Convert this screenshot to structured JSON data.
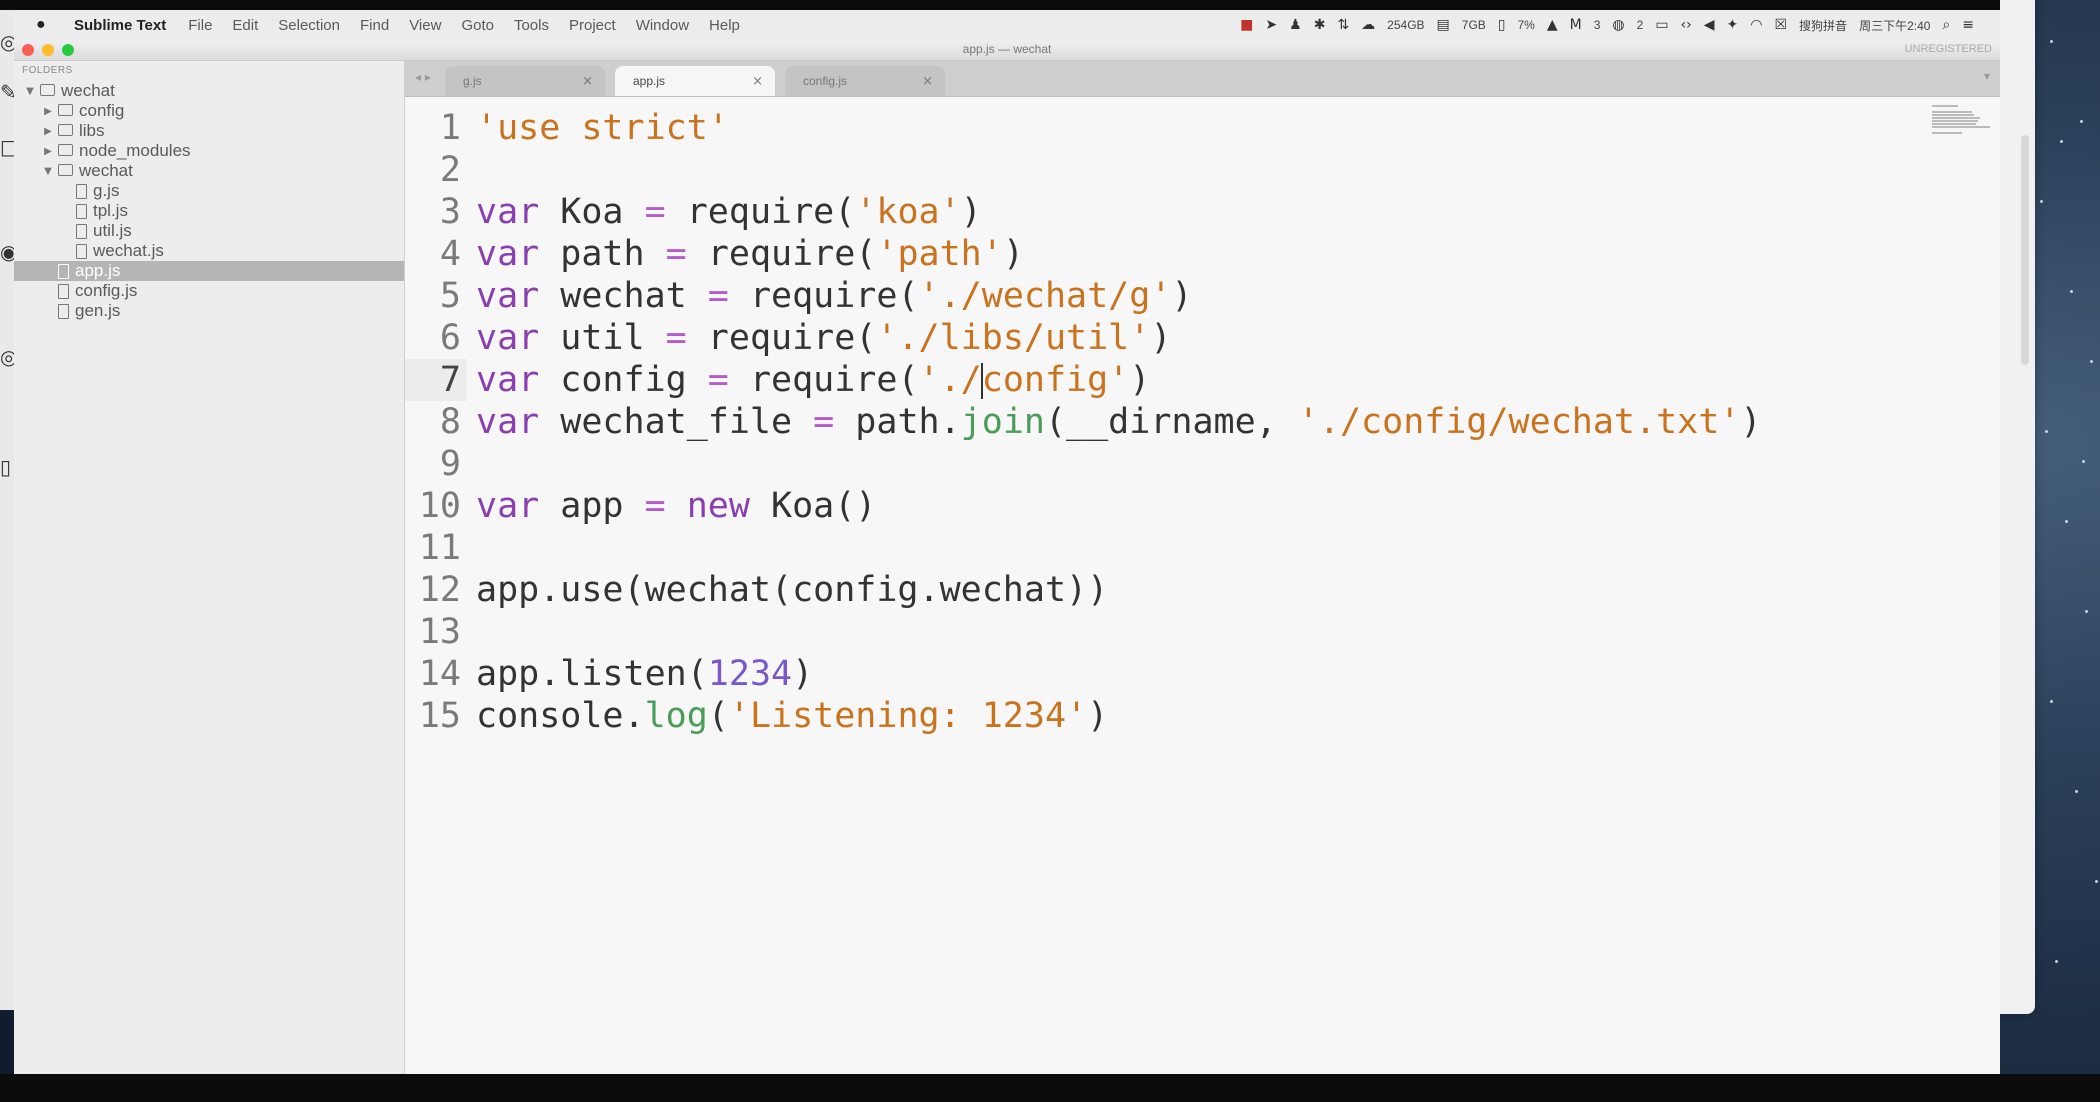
{
  "menubar": {
    "app_name": "Sublime Text",
    "items": [
      "File",
      "Edit",
      "Selection",
      "Find",
      "View",
      "Goto",
      "Tools",
      "Project",
      "Window",
      "Help"
    ],
    "status": {
      "disk": "254GB",
      "memory": "7GB",
      "cpu": "7%",
      "count_a": "3",
      "count_b": "2",
      "ime": "搜狗拼音",
      "clock": "周三下午2:40"
    }
  },
  "window": {
    "title": "app.js — wechat",
    "unregistered": "UNREGISTERED"
  },
  "sidebar": {
    "folders_label": "FOLDERS",
    "tree": [
      {
        "label": "wechat",
        "type": "folder",
        "level": 0,
        "expanded": true
      },
      {
        "label": "config",
        "type": "folder",
        "level": 1,
        "expanded": false
      },
      {
        "label": "libs",
        "type": "folder",
        "level": 1,
        "expanded": false
      },
      {
        "label": "node_modules",
        "type": "folder",
        "level": 1,
        "expanded": false
      },
      {
        "label": "wechat",
        "type": "folder",
        "level": 1,
        "expanded": true
      },
      {
        "label": "g.js",
        "type": "file",
        "level": 2
      },
      {
        "label": "tpl.js",
        "type": "file",
        "level": 2
      },
      {
        "label": "util.js",
        "type": "file",
        "level": 2
      },
      {
        "label": "wechat.js",
        "type": "file",
        "level": 2
      },
      {
        "label": "app.js",
        "type": "file",
        "level": 1,
        "selected": true
      },
      {
        "label": "config.js",
        "type": "file",
        "level": 1
      },
      {
        "label": "gen.js",
        "type": "file",
        "level": 1
      }
    ]
  },
  "tabs": [
    {
      "label": "g.js",
      "active": false
    },
    {
      "label": "app.js",
      "active": true
    },
    {
      "label": "config.js",
      "active": false
    }
  ],
  "editor": {
    "active_line": 7,
    "line_numbers": [
      "1",
      "2",
      "3",
      "4",
      "5",
      "6",
      "7",
      "8",
      "9",
      "10",
      "11",
      "12",
      "13",
      "14",
      "15"
    ],
    "lines": [
      [
        {
          "t": "s",
          "v": "'use strict'"
        }
      ],
      [],
      [
        {
          "t": "k",
          "v": "var"
        },
        {
          "t": "p",
          "v": " Koa "
        },
        {
          "t": "o",
          "v": "="
        },
        {
          "t": "p",
          "v": " require("
        },
        {
          "t": "s",
          "v": "'koa'"
        },
        {
          "t": "p",
          "v": ")"
        }
      ],
      [
        {
          "t": "k",
          "v": "var"
        },
        {
          "t": "p",
          "v": " path "
        },
        {
          "t": "o",
          "v": "="
        },
        {
          "t": "p",
          "v": " require("
        },
        {
          "t": "s",
          "v": "'path'"
        },
        {
          "t": "p",
          "v": ")"
        }
      ],
      [
        {
          "t": "k",
          "v": "var"
        },
        {
          "t": "p",
          "v": " wechat "
        },
        {
          "t": "o",
          "v": "="
        },
        {
          "t": "p",
          "v": " require("
        },
        {
          "t": "s",
          "v": "'./wechat/g'"
        },
        {
          "t": "p",
          "v": ")"
        }
      ],
      [
        {
          "t": "k",
          "v": "var"
        },
        {
          "t": "p",
          "v": " util "
        },
        {
          "t": "o",
          "v": "="
        },
        {
          "t": "p",
          "v": " require("
        },
        {
          "t": "s",
          "v": "'./libs/util'"
        },
        {
          "t": "p",
          "v": ")"
        }
      ],
      [
        {
          "t": "k",
          "v": "var"
        },
        {
          "t": "p",
          "v": " config "
        },
        {
          "t": "o",
          "v": "="
        },
        {
          "t": "p",
          "v": " require("
        },
        {
          "t": "s",
          "v": "'./"
        },
        {
          "t": "c",
          "v": ""
        },
        {
          "t": "s",
          "v": "config'"
        },
        {
          "t": "p",
          "v": ")"
        }
      ],
      [
        {
          "t": "k",
          "v": "var"
        },
        {
          "t": "p",
          "v": " wechat_file "
        },
        {
          "t": "o",
          "v": "="
        },
        {
          "t": "p",
          "v": " path."
        },
        {
          "t": "f",
          "v": "join"
        },
        {
          "t": "p",
          "v": "(__dirname, "
        },
        {
          "t": "s",
          "v": "'./config/wechat.txt'"
        },
        {
          "t": "p",
          "v": ")"
        }
      ],
      [],
      [
        {
          "t": "k",
          "v": "var"
        },
        {
          "t": "p",
          "v": " app "
        },
        {
          "t": "o",
          "v": "="
        },
        {
          "t": "p",
          "v": " "
        },
        {
          "t": "k",
          "v": "new"
        },
        {
          "t": "p",
          "v": " Koa()"
        }
      ],
      [],
      [
        {
          "t": "p",
          "v": "app.use(wechat(config.wechat))"
        }
      ],
      [],
      [
        {
          "t": "p",
          "v": "app.listen("
        },
        {
          "t": "n",
          "v": "1234"
        },
        {
          "t": "p",
          "v": ")"
        }
      ],
      [
        {
          "t": "p",
          "v": "console."
        },
        {
          "t": "f",
          "v": "log"
        },
        {
          "t": "p",
          "v": "("
        },
        {
          "t": "s",
          "v": "'Listening: 1234'"
        },
        {
          "t": "p",
          "v": ")"
        }
      ]
    ]
  },
  "colors": {
    "keyword": "#8a3fb1",
    "string": "#c9731e",
    "number": "#7a58c8",
    "operator": "#b45cc9",
    "function": "#4a9c59",
    "text": "#333333"
  }
}
